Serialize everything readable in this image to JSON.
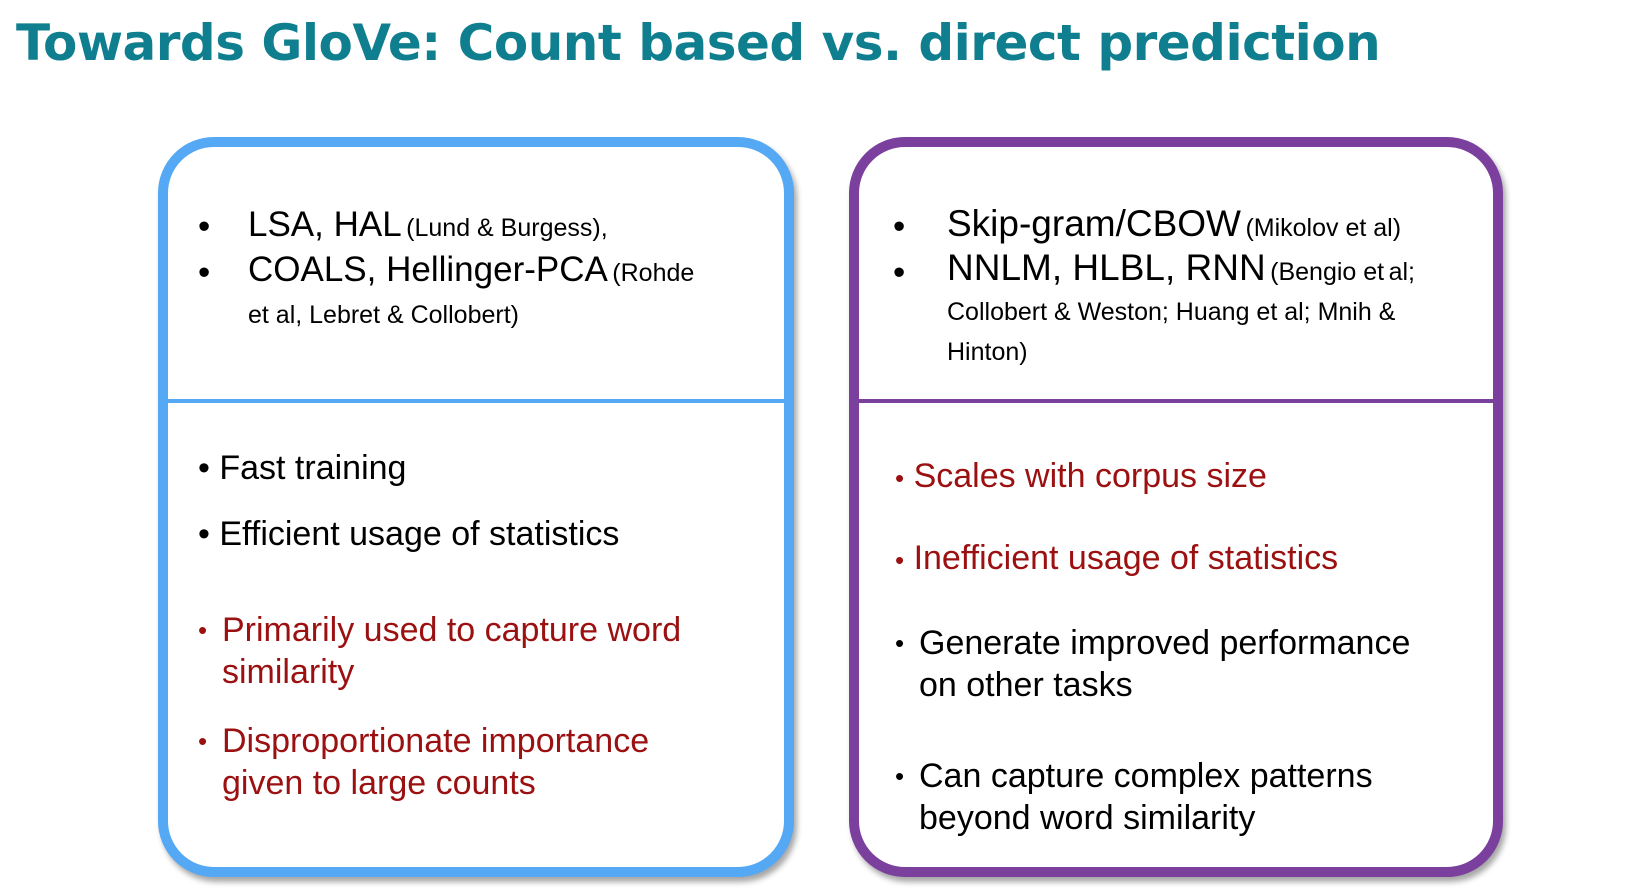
{
  "title": "Towards GloVe: Count based vs. direct prediction",
  "left_box": {
    "methods": [
      {
        "main": "LSA, HAL",
        "cite": "(Lund & Burgess),",
        "cite2": ""
      },
      {
        "main": "COALS, Hellinger-PCA",
        "cite": "(Rohde",
        "cite2": "et al, Lebret & Collobert)"
      }
    ],
    "points": [
      {
        "text": "Fast training",
        "color": "#000000"
      },
      {
        "text": "Efficient usage of statistics",
        "color": "#000000"
      },
      {
        "text": "Primarily used to capture word similarity",
        "color": "#9b1010"
      },
      {
        "text": "Disproportionate importance given to large counts",
        "color": "#9b1010"
      }
    ],
    "border_color": "#55a8f4"
  },
  "right_box": {
    "methods": [
      {
        "main": "Skip-gram/CBOW",
        "cite": "(Mikolov et al)",
        "cite2": ""
      },
      {
        "main": "NNLM, HLBL, RNN",
        "cite": "(Bengio et",
        "cite2": "al; Collobert & Weston; Huang et al; Mnih & Hinton)"
      }
    ],
    "points": [
      {
        "text": "Scales with corpus size",
        "color": "#9b1010"
      },
      {
        "text": "Inefficient usage of statistics",
        "color": "#9b1010"
      },
      {
        "text": "Generate improved performance on other tasks",
        "color": "#000000"
      },
      {
        "text": "Can capture complex patterns beyond word similarity",
        "color": "#000000"
      }
    ],
    "border_color": "#7b3f9e"
  },
  "bullet": "•"
}
